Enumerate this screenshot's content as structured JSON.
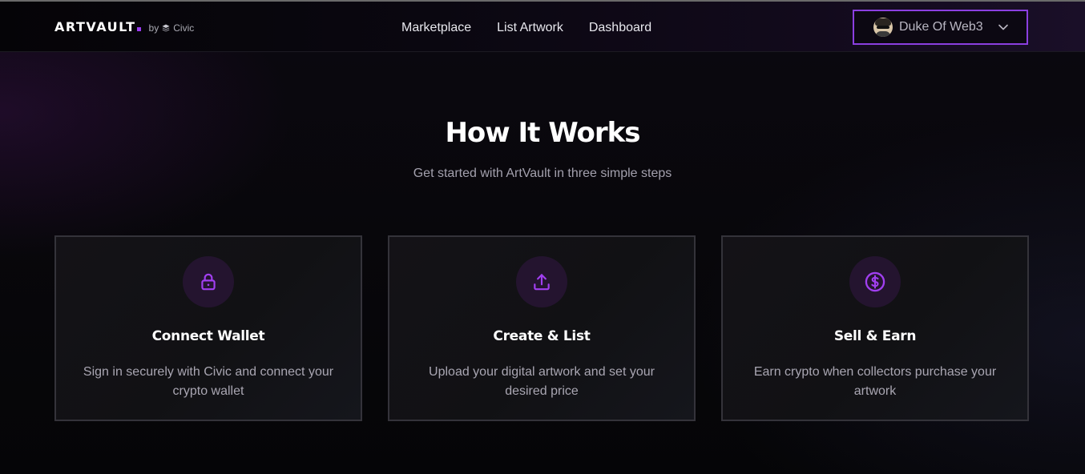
{
  "colors": {
    "accent": "#9b3cf2",
    "border_accent": "#8b3fe0",
    "background": "#08070b",
    "card_background": "#131216",
    "card_border": "#34333a",
    "muted_text": "#a3a0ad"
  },
  "header": {
    "brand": "ARTVAULT",
    "by_label": "by",
    "partner": "Civic",
    "partner_icon": "civic-layers-icon",
    "nav": [
      {
        "label": "Marketplace"
      },
      {
        "label": "List Artwork"
      },
      {
        "label": "Dashboard"
      }
    ],
    "user": {
      "name": "Duke Of Web3",
      "avatar_icon": "user-avatar",
      "menu_icon": "chevron-down-icon"
    }
  },
  "hero": {
    "title": "How It Works",
    "subtitle": "Get started with ArtVault in three simple steps"
  },
  "steps": [
    {
      "icon": "lock-icon",
      "title": "Connect Wallet",
      "description": "Sign in securely with Civic and connect your crypto wallet"
    },
    {
      "icon": "upload-icon",
      "title": "Create & List",
      "description": "Upload your digital artwork and set your desired price"
    },
    {
      "icon": "dollar-icon",
      "title": "Sell & Earn",
      "description": "Earn crypto when collectors purchase your artwork"
    }
  ]
}
